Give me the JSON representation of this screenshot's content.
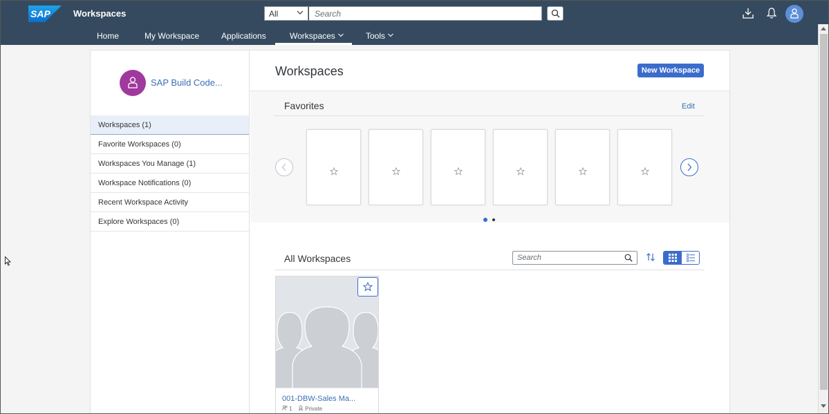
{
  "header": {
    "brand": "SAP",
    "app_title": "Workspaces",
    "search_scope": "All",
    "search_placeholder": "Search",
    "nav": [
      {
        "label": "Home"
      },
      {
        "label": "My Workspace"
      },
      {
        "label": "Applications"
      },
      {
        "label": "Workspaces"
      },
      {
        "label": "Tools"
      }
    ]
  },
  "sidebar": {
    "profile_name": "SAP Build Code...",
    "items": [
      {
        "label": "Workspaces (1)",
        "selected": true
      },
      {
        "label": "Favorite Workspaces (0)"
      },
      {
        "label": "Workspaces You Manage (1)"
      },
      {
        "label": "Workspace Notifications (0)"
      },
      {
        "label": "Recent Workspace Activity"
      },
      {
        "label": "Explore Workspaces (0)"
      }
    ]
  },
  "main": {
    "title": "Workspaces",
    "new_button": "New Workspace",
    "favorites": {
      "title": "Favorites",
      "edit": "Edit",
      "tile_count": 6,
      "page_dots": 2,
      "active_dot": 0
    },
    "all_workspaces": {
      "title": "All Workspaces",
      "search_placeholder": "Search",
      "cards": [
        {
          "name": "001-DBW-Sales Ma...",
          "members": "1",
          "visibility": "Private"
        }
      ]
    }
  },
  "colors": {
    "shellbar": "#354a5f",
    "accent": "#3b6ccc",
    "link": "#3a6fb5",
    "avatar": "#a0399d"
  }
}
